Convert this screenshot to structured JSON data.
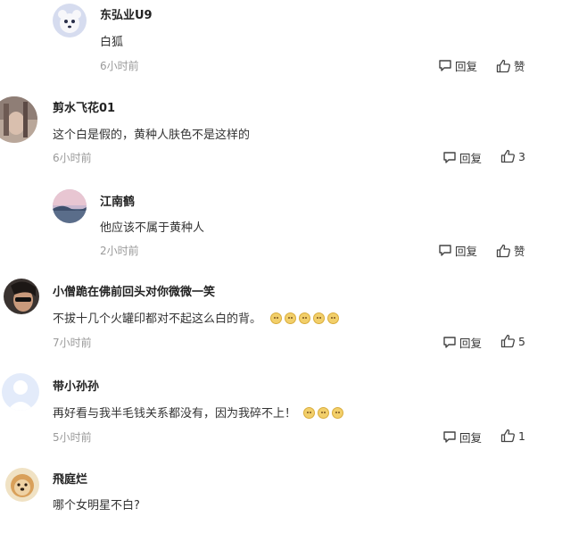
{
  "colors": {
    "text": "#222222",
    "meta": "#9a9a9a",
    "emoji": "#f2cf6a"
  },
  "comments": [
    {
      "user": "东弘业U9",
      "text": "白狐",
      "time": "6小时前",
      "reply": "回复",
      "like": "赞",
      "emoji_count": 0,
      "reply_level": true
    },
    {
      "user": "剪水飞花01",
      "text": "这个白是假的，黄种人肤色不是这样的",
      "time": "6小时前",
      "reply": "回复",
      "like": "3",
      "emoji_count": 0,
      "reply_level": false
    },
    {
      "user": "江南鹤",
      "text": "他应该不属于黄种人",
      "time": "2小时前",
      "reply": "回复",
      "like": "赞",
      "emoji_count": 0,
      "reply_level": true
    },
    {
      "user": "小僧跪在佛前回头对你微微一笑",
      "text": "不拔十几个火罐印都对不起这么白的背。",
      "time": "7小时前",
      "reply": "回复",
      "like": "5",
      "emoji_count": 5,
      "reply_level": false
    },
    {
      "user": "带小孙孙",
      "text": "再好看与我半毛钱关系都没有，因为我碎不上！",
      "time": "5小时前",
      "reply": "回复",
      "like": "1",
      "emoji_count": 3,
      "reply_level": false
    },
    {
      "user": "飛庭烂",
      "text": "哪个女明星不白?",
      "time": "",
      "reply": "",
      "like": "",
      "emoji_count": 0,
      "reply_level": false
    }
  ]
}
